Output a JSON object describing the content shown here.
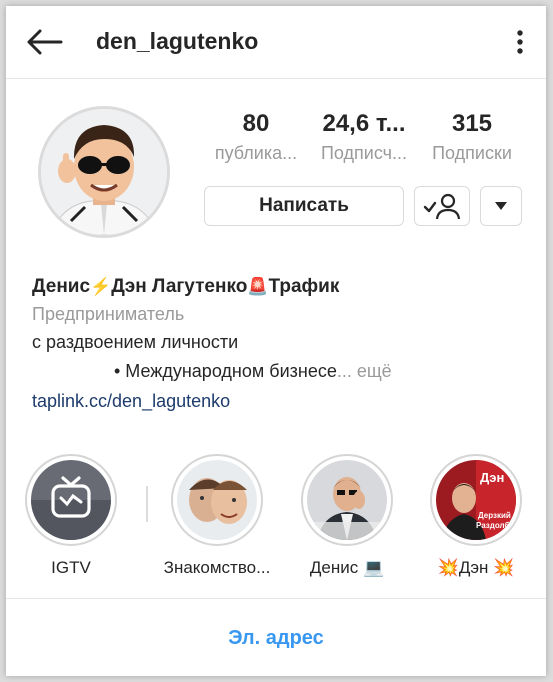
{
  "header": {
    "username": "den_lagutenko"
  },
  "profile": {
    "stats": [
      {
        "value": "80",
        "label": "публика..."
      },
      {
        "value": "24,6 т...",
        "label": "Подписч..."
      },
      {
        "value": "315",
        "label": "Подписки"
      }
    ],
    "message_button": "Написать",
    "full_name_parts": [
      "Денис",
      "⚡",
      "Дэн Лагутенко",
      "🚨",
      "Трафик"
    ],
    "category": "Предприниматель",
    "bio_line1": "с раздвоением личности",
    "bio_line2": "• Международном бизнесе",
    "more": "... ещё",
    "link": "taplink.cc/den_lagutenko"
  },
  "highlights": [
    {
      "label": "IGTV",
      "icon": "igtv-icon"
    },
    {
      "label": "Знакомство..."
    },
    {
      "label": "Денис 💻"
    },
    {
      "label": "💥Дэн 💥",
      "image_text_1": "Дэн",
      "image_text_2": "Дерзкий",
      "image_text_3": "Раздолба"
    }
  ],
  "contact": {
    "email_label": "Эл. адрес"
  },
  "colors": {
    "link_blue": "#3897f0",
    "bio_link": "#1d3b6c",
    "text": "#262626",
    "muted": "#9a9a9a",
    "border": "#dbdbdb"
  }
}
